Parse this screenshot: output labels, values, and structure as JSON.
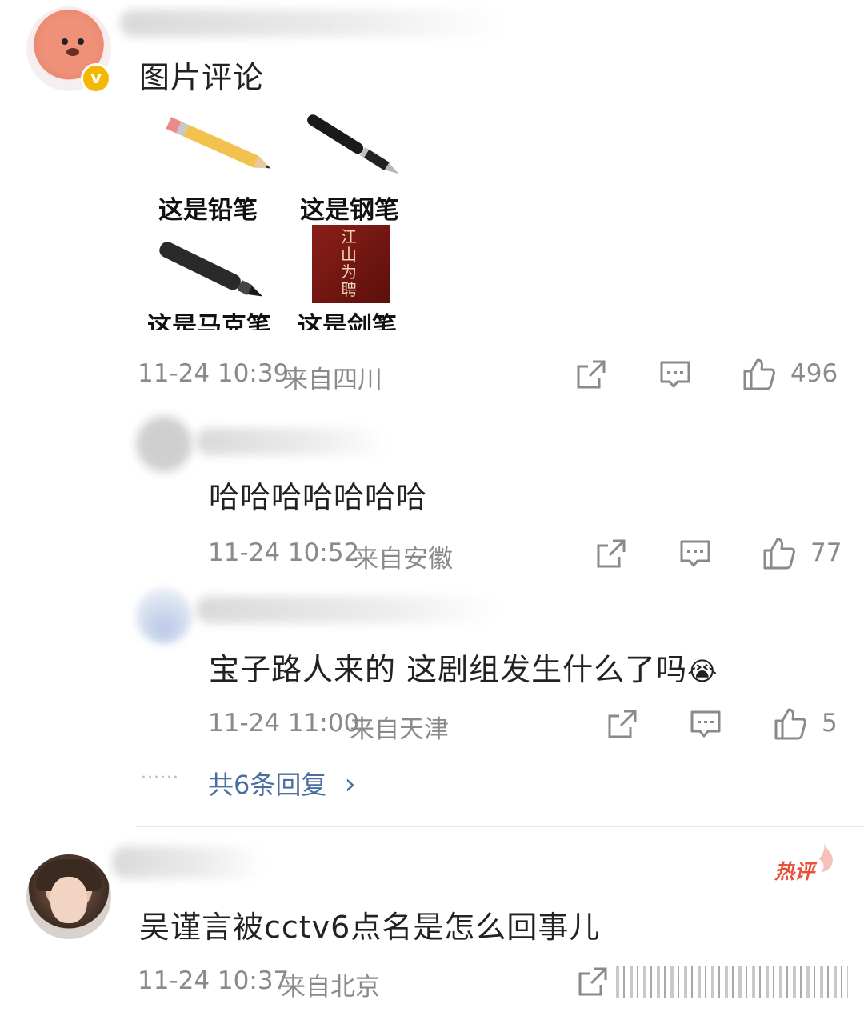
{
  "comments": [
    {
      "text": "图片评论",
      "image": {
        "captions": [
          "这是铅笔",
          "这是钢笔",
          "这是马克笔",
          "这是剑笔"
        ],
        "poster_text": "江山为聘"
      },
      "time": "11-24 10:39",
      "location": "来自四川",
      "likes": "496"
    },
    {
      "text": "哈哈哈哈哈哈哈",
      "time": "11-24 10:52",
      "location": "来自安徽",
      "likes": "77"
    },
    {
      "text": "宝子路人来的 这剧组发生什么了吗",
      "emoji": "😭",
      "time": "11-24 11:00",
      "location": "来自天津",
      "likes": "5"
    },
    {
      "text": "吴谨言被cctv6点名是怎么回事儿",
      "badge": "热评",
      "time": "11-24 10:37",
      "location": "来自北京"
    }
  ],
  "more_replies": {
    "dots": "······",
    "label": "共6条回复",
    "chevron": "›"
  },
  "icons": [
    "share-icon",
    "comment-icon",
    "like-icon",
    "verified-badge-icon"
  ],
  "colors": {
    "meta": "#8a8a8a",
    "link": "#4a6ea0",
    "hot": "#e8503a",
    "verified": "#f5b800"
  }
}
